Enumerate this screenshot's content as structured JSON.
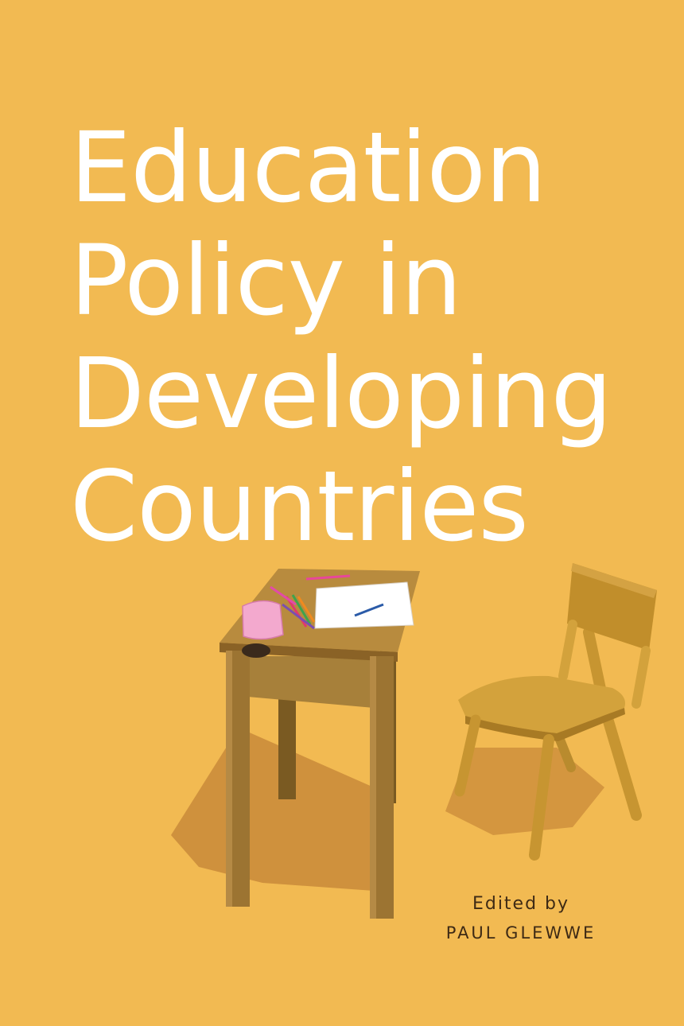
{
  "cover": {
    "background": "#F2BA52",
    "title_lines": [
      "Education",
      "Policy in",
      "Developing",
      "Countries"
    ],
    "edited_label": "Edited by",
    "editor_name": "PAUL GLEWWE"
  },
  "illustration": {
    "objects": [
      "school-desk",
      "school-chair",
      "writing-paper",
      "pencil",
      "colored-pencils",
      "pink-eraser"
    ]
  }
}
